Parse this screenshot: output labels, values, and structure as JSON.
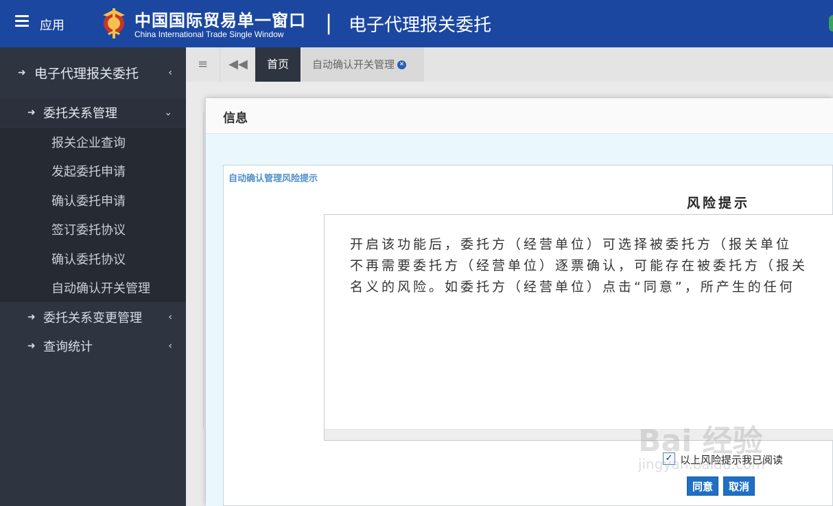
{
  "header": {
    "app_label": "应用",
    "brand_cn": "中国国际贸易单一窗口",
    "brand_en": "China International Trade Single Window",
    "divider": "|",
    "system_title": "电子代理报关委托",
    "colors": {
      "bar": "#1b47a0"
    }
  },
  "sidebar": {
    "root_label": "电子代理报关委托",
    "group_label": "委托关系管理",
    "sub_items": [
      {
        "label": "报关企业查询"
      },
      {
        "label": "发起委托申请"
      },
      {
        "label": "确认委托申请"
      },
      {
        "label": "签订委托协议"
      },
      {
        "label": "确认委托协议"
      },
      {
        "label": "自动确认开关管理"
      }
    ],
    "group2_label": "委托关系变更管理",
    "group3_label": "查询统计"
  },
  "tabs": {
    "home": "首页",
    "active": "自动确认开关管理"
  },
  "modal": {
    "title": "信息",
    "panel_title": "自动确认管理风险提示",
    "risk_heading": "风险提示",
    "notice_lines": [
      "开启该功能后，委托方（经营单位）可选择被委托方（报关单位",
      "不再需要委托方（经营单位）逐票确认，可能存在被委托方（报关",
      "名义的风险。如委托方（经营单位）点击“同意”，所产生的任何"
    ],
    "ack_label": "以上风险提示我已阅读",
    "agree_button": "同意",
    "cancel_button": "取消"
  },
  "watermark": {
    "main": "Bai 经验",
    "sub": "jingyan.baidu.com"
  }
}
